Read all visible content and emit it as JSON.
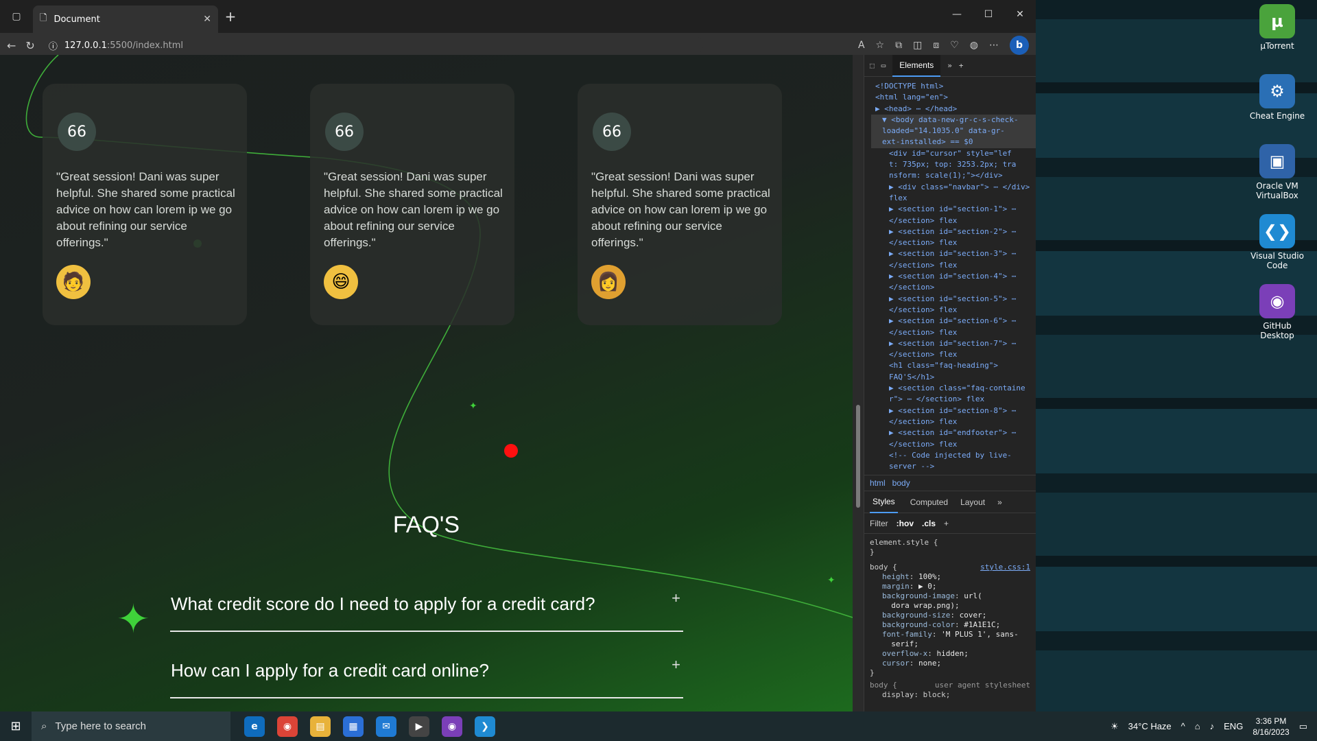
{
  "browser": {
    "tab_title": "Document",
    "url_host": "127.0.0.1",
    "url_path": ":5500/index.html"
  },
  "page": {
    "testimonials": [
      {
        "badge": "66",
        "quote": "\"Great session! Dani was super helpful. She shared some practical advice on how can lorem ip we go about refining our service offerings.\"",
        "avatar_icon": "man-avatar-icon"
      },
      {
        "badge": "66",
        "quote": "\"Great session! Dani was super helpful. She shared some practical advice on how can lorem ip we go about refining our service offerings.\"",
        "avatar_icon": "man-smiling-avatar-icon"
      },
      {
        "badge": "66",
        "quote": "\"Great session! Dani was super helpful. She shared some practical advice on how can lorem ip we go about refining our service offerings.\"",
        "avatar_icon": "woman-avatar-icon"
      }
    ],
    "faq_heading": "FAQ'S",
    "faqs": [
      {
        "question": "What credit score do I need to apply for a credit card?",
        "toggle": "+"
      },
      {
        "question": "How can I apply for a credit card online?",
        "toggle": "+"
      }
    ],
    "accent_color": "#3fd13a",
    "cursor_dot_color": "#ff1010"
  },
  "devtools": {
    "active_tab": "Elements",
    "dom_lines": [
      "<!DOCTYPE html>",
      "<html lang=\"en\">",
      "▶ <head> ⋯ </head>",
      "▼ <body data-new-gr-c-s-check-",
      "loaded=\"14.1035.0\" data-gr-",
      "ext-installed> == $0",
      "<div id=\"cursor\" style=\"lef",
      "t: 735px; top: 3253.2px; tra",
      "nsform: scale(1);\"></div>",
      "▶ <div class=\"navbar\"> ⋯ </div>",
      "flex",
      "▶ <section id=\"section-1\"> ⋯",
      "</section> flex",
      "▶ <section id=\"section-2\"> ⋯",
      "</section> flex",
      "▶ <section id=\"section-3\"> ⋯",
      "</section> flex",
      "▶ <section id=\"section-4\"> ⋯",
      "</section>",
      "▶ <section id=\"section-5\"> ⋯",
      "</section> flex",
      "▶ <section id=\"section-6\"> ⋯",
      "</section> flex",
      "▶ <section id=\"section-7\"> ⋯",
      "</section> flex",
      "<h1 class=\"faq-heading\">",
      "FAQ'S</h1>",
      "▶ <section class=\"faq-containe",
      "r\"> ⋯ </section> flex",
      "▶ <section id=\"section-8\"> ⋯",
      "</section> flex",
      "▶ <section id=\"endfooter\"> ⋯",
      "</section> flex",
      "<!-- Code injected by live-",
      "server -->"
    ],
    "breadcrumbs": [
      "html",
      "body"
    ],
    "style_tabs": [
      "Styles",
      "Computed",
      "Layout"
    ],
    "filter_label": "Filter",
    "hov": ":hov",
    "cls": ".cls",
    "element_style": "element.style {",
    "close_brace": "}",
    "body_rule": "body {",
    "source_link": "style.css:1",
    "properties": [
      {
        "name": "height",
        "value": "100%;"
      },
      {
        "name": "margin",
        "value": "▶ 0;"
      },
      {
        "name": "background-image",
        "value": "url("
      },
      {
        "name": "",
        "value": "dora wrap.png);"
      },
      {
        "name": "background-size",
        "value": "cover;"
      },
      {
        "name": "background-color",
        "value": "#1A1E1C;"
      },
      {
        "name": "font-family",
        "value": "'M PLUS 1', sans-"
      },
      {
        "name": "",
        "value": "serif;"
      },
      {
        "name": "overflow-x",
        "value": "hidden;"
      },
      {
        "name": "cursor",
        "value": "none;"
      }
    ],
    "ua_rule": "body {",
    "ua_label": "user agent stylesheet",
    "ua_prop": "display: block;"
  },
  "desktop_icons": [
    {
      "label": "µTorrent",
      "icon": "utorrent-icon",
      "color": "#4aa33c",
      "glyph": "µ"
    },
    {
      "label": "Cheat Engine",
      "icon": "cheat-engine-icon",
      "color": "#2a6fb5",
      "glyph": "⚙"
    },
    {
      "label": "Oracle VM VirtualBox",
      "icon": "virtualbox-icon",
      "color": "#2f63a8",
      "glyph": "▣"
    },
    {
      "label": "Visual Studio Code",
      "icon": "vscode-icon",
      "color": "#1f8ad2",
      "glyph": "❮❯"
    },
    {
      "label": "GitHub Desktop",
      "icon": "github-desktop-icon",
      "color": "#7b3fb8",
      "glyph": "◉"
    }
  ],
  "taskbar": {
    "search_placeholder": "Type here to search",
    "weather": "34°C  Haze",
    "language": "ENG",
    "time": "3:36 PM",
    "date": "8/16/2023"
  }
}
